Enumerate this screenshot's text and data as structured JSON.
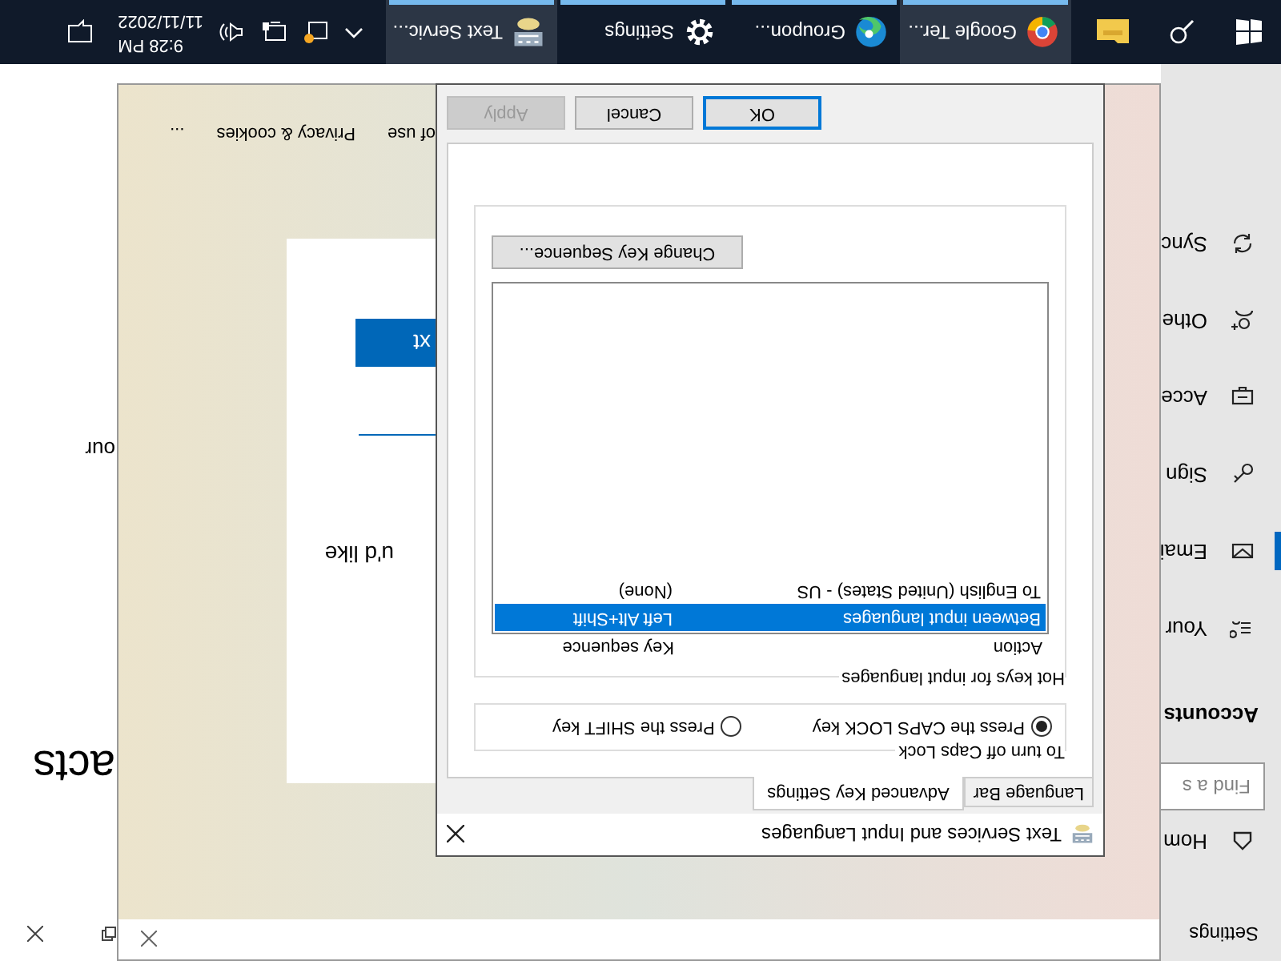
{
  "settings_window": {
    "title": "Settings",
    "nav": [
      {
        "kind": "link",
        "label": "Hom",
        "selected": false
      },
      {
        "kind": "search",
        "placeholder": "Find a s"
      },
      {
        "kind": "heading",
        "label": "Accounts"
      },
      {
        "kind": "link",
        "label": "Your",
        "selected": false
      },
      {
        "kind": "link",
        "label": "Emai",
        "selected": true
      },
      {
        "kind": "link",
        "label": "Sign",
        "selected": false
      },
      {
        "kind": "link",
        "label": "Acce",
        "selected": false
      },
      {
        "kind": "link",
        "label": "Othe",
        "selected": false
      },
      {
        "kind": "link",
        "label": "Sync",
        "selected": false
      }
    ],
    "content_heading": "acts",
    "content_text": "our"
  },
  "browser_window": {
    "card": {
      "text": "u'd like",
      "button": "xt"
    },
    "footer": [
      "of use",
      "Privacy & cookies",
      "..."
    ]
  },
  "dialog": {
    "title": "Text Services and Input Languages",
    "tabs": [
      {
        "label": "Language Bar",
        "selected": false
      },
      {
        "label": "Advanced Key Settings",
        "selected": true
      }
    ],
    "caps_lock": {
      "title": "To turn off Caps Lock",
      "options": [
        {
          "label": "Press the CAPS LOCK key",
          "selected": true
        },
        {
          "label": "Press the SHIFT key",
          "selected": false
        }
      ]
    },
    "hotkeys": {
      "title": "Hot keys for input languages",
      "columns": [
        "Action",
        "Key sequence"
      ],
      "rows": [
        {
          "action": "Between input languages",
          "key_sequence": "Left Alt+Shift",
          "selected": true
        },
        {
          "action": "To English (United States) - US",
          "key_sequence": "(None)",
          "selected": false
        }
      ],
      "change_button": "Change Key Sequence..."
    },
    "buttons": [
      {
        "label": "OK",
        "default": true,
        "disabled": false
      },
      {
        "label": "Cancel",
        "default": false,
        "disabled": false
      },
      {
        "label": "Apply",
        "default": false,
        "disabled": true
      }
    ]
  },
  "taskbar": {
    "apps": [
      {
        "kind": "chrome",
        "label": "Google Ter...",
        "active": true
      },
      {
        "kind": "edge",
        "label": "Groupon...",
        "active": false
      },
      {
        "kind": "gear",
        "label": "Settings",
        "active": false
      },
      {
        "kind": "keyboard",
        "label": "Text Servic...",
        "active": true
      }
    ],
    "time": "9:28 PM",
    "date": "11/11/2022"
  }
}
